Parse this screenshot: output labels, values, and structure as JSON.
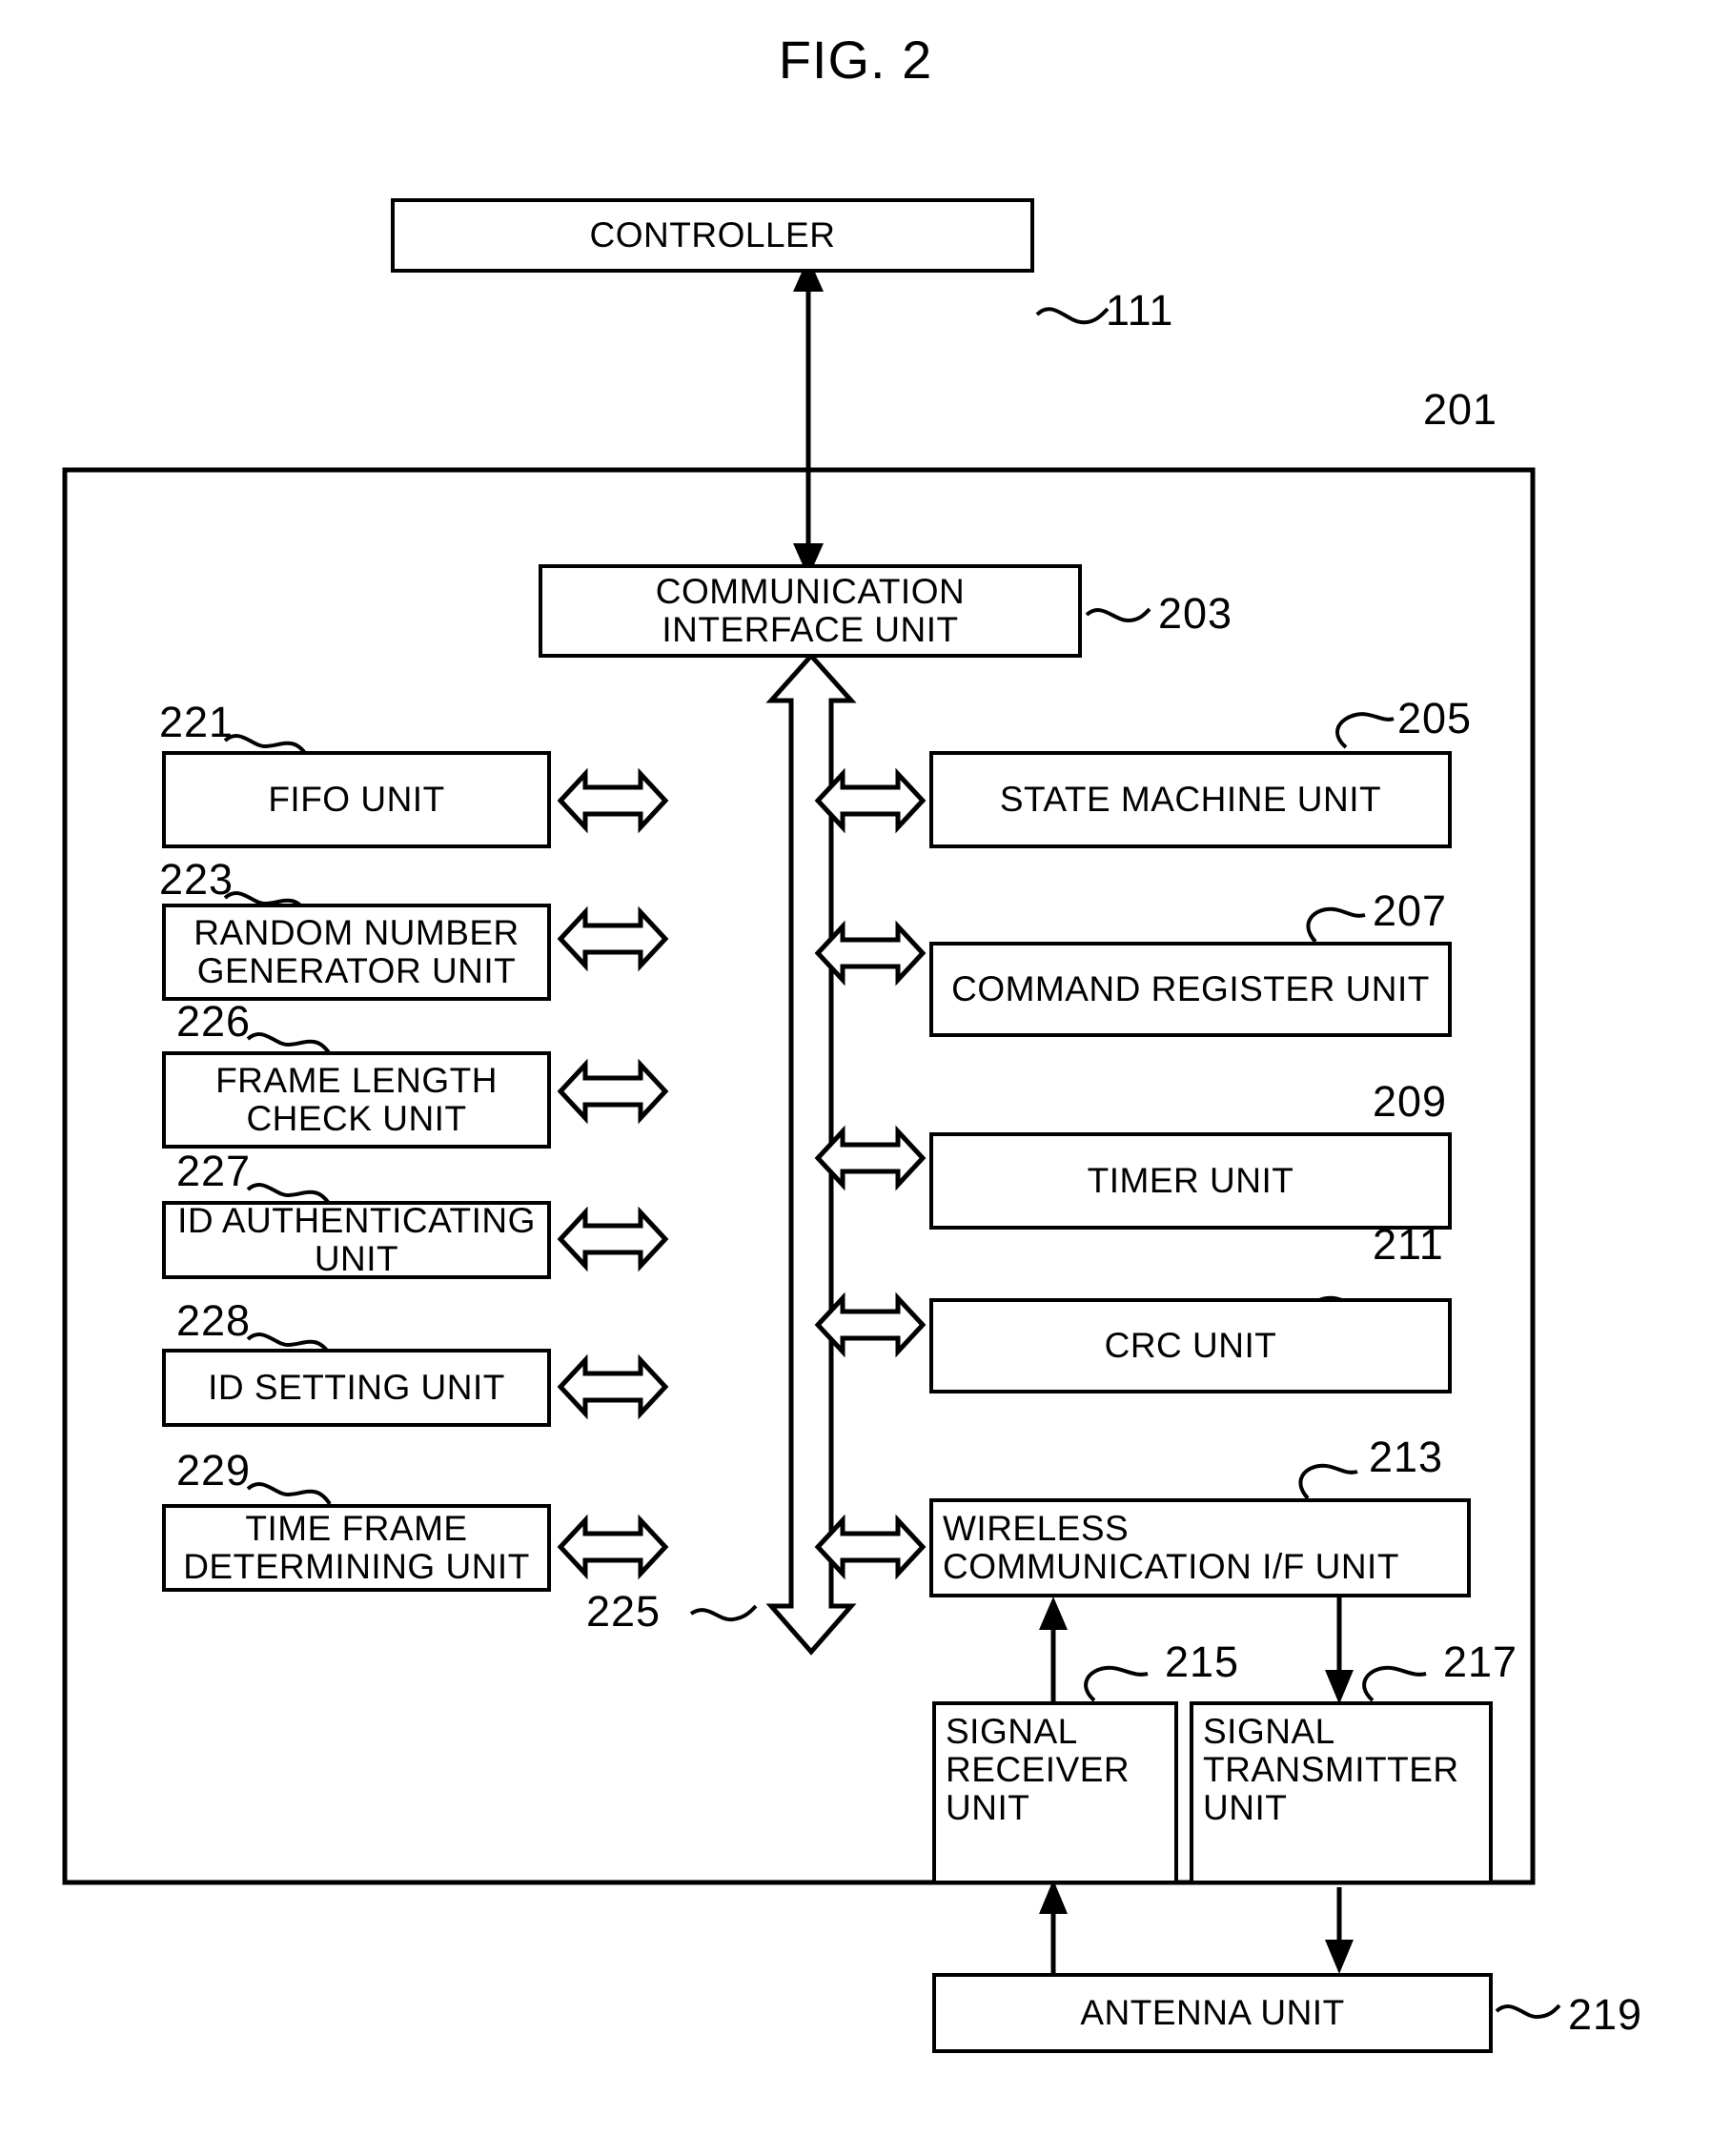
{
  "figure": {
    "title": "FIG. 2"
  },
  "blocks": {
    "controller": {
      "label": "CONTROLLER",
      "ref": "111"
    },
    "enclosure": {
      "ref": "201"
    },
    "comm_if": {
      "label": "COMMUNICATION\nINTERFACE UNIT",
      "ref": "203"
    },
    "bus": {
      "ref": "225"
    },
    "fifo": {
      "label": "FIFO UNIT",
      "ref": "221"
    },
    "rng": {
      "label": "RANDOM NUMBER\nGENERATOR UNIT",
      "ref": "223"
    },
    "frame_len": {
      "label": "FRAME LENGTH\nCHECK UNIT",
      "ref": "226"
    },
    "id_auth": {
      "label": "ID AUTHENTICATING UNIT",
      "ref": "227"
    },
    "id_set": {
      "label": "ID SETTING UNIT",
      "ref": "228"
    },
    "time_frame": {
      "label": "TIME FRAME\nDETERMINING UNIT",
      "ref": "229"
    },
    "state_machine": {
      "label": "STATE MACHINE UNIT",
      "ref": "205"
    },
    "cmd_reg": {
      "label": "COMMAND REGISTER UNIT",
      "ref": "207"
    },
    "timer": {
      "label": "TIMER UNIT",
      "ref": "209"
    },
    "crc": {
      "label": "CRC UNIT",
      "ref": "211"
    },
    "wireless_if": {
      "label": "WIRELESS\nCOMMUNICATION I/F UNIT",
      "ref": "213"
    },
    "sig_rx": {
      "label": "SIGNAL\nRECEIVER\nUNIT",
      "ref": "215"
    },
    "sig_tx": {
      "label": "SIGNAL\nTRANSMITTER\nUNIT",
      "ref": "217"
    },
    "antenna": {
      "label": "ANTENNA UNIT",
      "ref": "219"
    }
  },
  "colors": {
    "line": "#000000",
    "background": "#ffffff"
  }
}
